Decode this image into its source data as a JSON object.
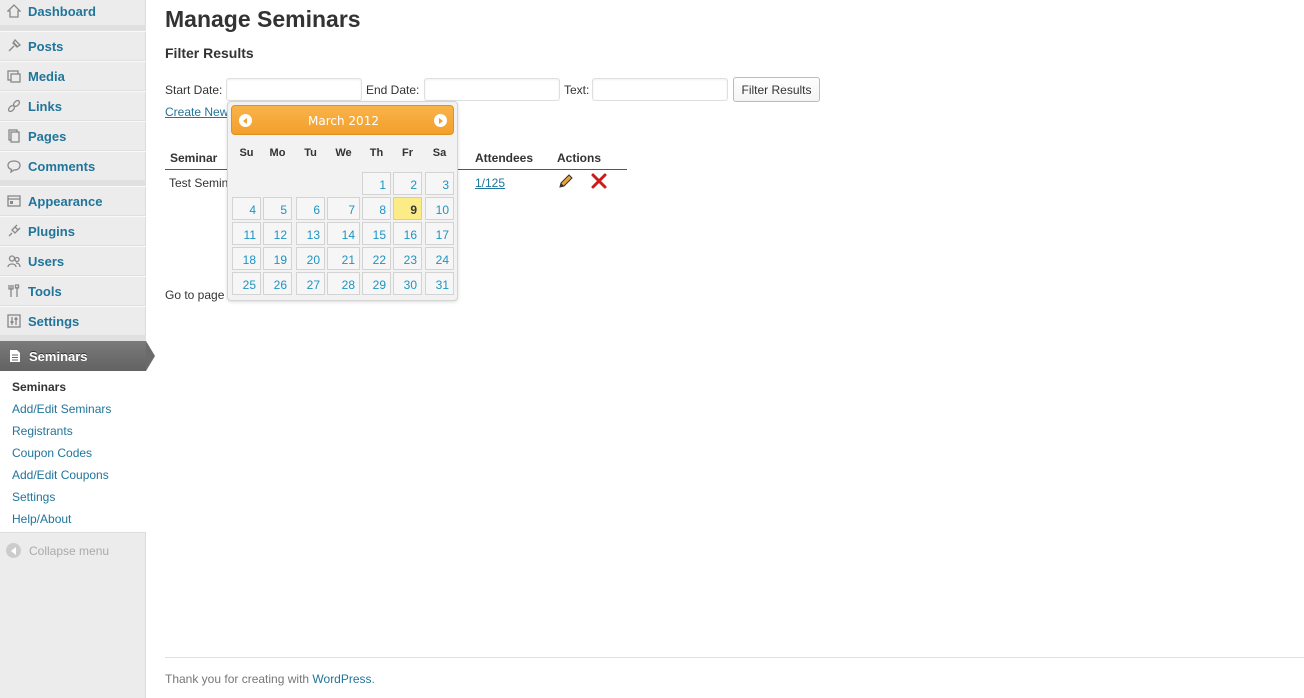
{
  "sidebar": {
    "items": [
      {
        "label": "Dashboard",
        "icon": "dashboard-icon"
      },
      {
        "label": "Posts",
        "icon": "posts-icon"
      },
      {
        "label": "Media",
        "icon": "media-icon"
      },
      {
        "label": "Links",
        "icon": "links-icon"
      },
      {
        "label": "Pages",
        "icon": "pages-icon"
      },
      {
        "label": "Comments",
        "icon": "comments-icon"
      },
      {
        "label": "Appearance",
        "icon": "appearance-icon"
      },
      {
        "label": "Plugins",
        "icon": "plugins-icon"
      },
      {
        "label": "Users",
        "icon": "users-icon"
      },
      {
        "label": "Tools",
        "icon": "tools-icon"
      },
      {
        "label": "Settings",
        "icon": "settings-icon"
      }
    ],
    "current": {
      "label": "Seminars",
      "icon": "seminars-icon"
    },
    "submenu": [
      "Seminars",
      "Add/Edit Seminars",
      "Registrants",
      "Coupon Codes",
      "Add/Edit Coupons",
      "Settings",
      "Help/About"
    ],
    "collapse_label": "Collapse menu"
  },
  "main": {
    "title": "Manage Seminars",
    "filter_heading": "Filter Results",
    "start_date_label": "Start Date:",
    "end_date_label": "End Date:",
    "text_label": "Text:",
    "filter_button": "Filter Results",
    "create_link": "Create New Seminar",
    "table": {
      "headers": {
        "seminar": "Seminar",
        "attendees": "Attendees",
        "actions": "Actions"
      },
      "rows": [
        {
          "seminar": "Test Seminar",
          "attendees": "1/125"
        }
      ]
    },
    "goto_label": "Go to page"
  },
  "datepicker": {
    "title": "March 2012",
    "dow": [
      "Su",
      "Mo",
      "Tu",
      "We",
      "Th",
      "Fr",
      "Sa"
    ],
    "first_weekday": 4,
    "days_in_month": 31,
    "today": 9
  },
  "footer": {
    "text": "Thank you for creating with ",
    "link": "WordPress",
    "end": "."
  },
  "colors": {
    "link": "#21759b",
    "accent": "#f2a02b",
    "today": "#fbec88"
  }
}
